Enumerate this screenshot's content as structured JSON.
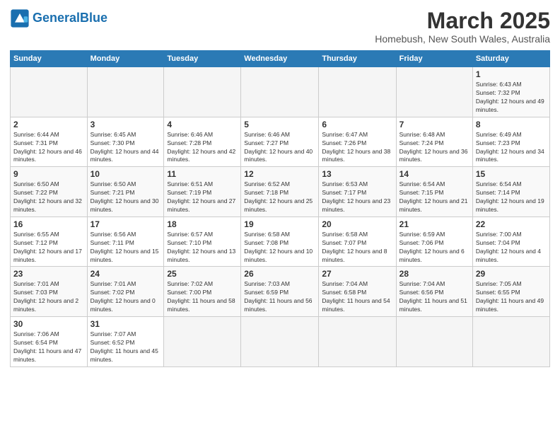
{
  "header": {
    "logo_general": "General",
    "logo_blue": "Blue",
    "title": "March 2025",
    "subtitle": "Homebush, New South Wales, Australia"
  },
  "columns": [
    "Sunday",
    "Monday",
    "Tuesday",
    "Wednesday",
    "Thursday",
    "Friday",
    "Saturday"
  ],
  "weeks": [
    {
      "days": [
        {
          "num": "",
          "info": ""
        },
        {
          "num": "",
          "info": ""
        },
        {
          "num": "",
          "info": ""
        },
        {
          "num": "",
          "info": ""
        },
        {
          "num": "",
          "info": ""
        },
        {
          "num": "",
          "info": ""
        },
        {
          "num": "1",
          "info": "Sunrise: 6:43 AM\nSunset: 7:32 PM\nDaylight: 12 hours and 49 minutes."
        }
      ]
    },
    {
      "days": [
        {
          "num": "2",
          "info": "Sunrise: 6:44 AM\nSunset: 7:31 PM\nDaylight: 12 hours and 46 minutes."
        },
        {
          "num": "3",
          "info": "Sunrise: 6:45 AM\nSunset: 7:30 PM\nDaylight: 12 hours and 44 minutes."
        },
        {
          "num": "4",
          "info": "Sunrise: 6:46 AM\nSunset: 7:28 PM\nDaylight: 12 hours and 42 minutes."
        },
        {
          "num": "5",
          "info": "Sunrise: 6:46 AM\nSunset: 7:27 PM\nDaylight: 12 hours and 40 minutes."
        },
        {
          "num": "6",
          "info": "Sunrise: 6:47 AM\nSunset: 7:26 PM\nDaylight: 12 hours and 38 minutes."
        },
        {
          "num": "7",
          "info": "Sunrise: 6:48 AM\nSunset: 7:24 PM\nDaylight: 12 hours and 36 minutes."
        },
        {
          "num": "8",
          "info": "Sunrise: 6:49 AM\nSunset: 7:23 PM\nDaylight: 12 hours and 34 minutes."
        }
      ]
    },
    {
      "days": [
        {
          "num": "9",
          "info": "Sunrise: 6:50 AM\nSunset: 7:22 PM\nDaylight: 12 hours and 32 minutes."
        },
        {
          "num": "10",
          "info": "Sunrise: 6:50 AM\nSunset: 7:21 PM\nDaylight: 12 hours and 30 minutes."
        },
        {
          "num": "11",
          "info": "Sunrise: 6:51 AM\nSunset: 7:19 PM\nDaylight: 12 hours and 27 minutes."
        },
        {
          "num": "12",
          "info": "Sunrise: 6:52 AM\nSunset: 7:18 PM\nDaylight: 12 hours and 25 minutes."
        },
        {
          "num": "13",
          "info": "Sunrise: 6:53 AM\nSunset: 7:17 PM\nDaylight: 12 hours and 23 minutes."
        },
        {
          "num": "14",
          "info": "Sunrise: 6:54 AM\nSunset: 7:15 PM\nDaylight: 12 hours and 21 minutes."
        },
        {
          "num": "15",
          "info": "Sunrise: 6:54 AM\nSunset: 7:14 PM\nDaylight: 12 hours and 19 minutes."
        }
      ]
    },
    {
      "days": [
        {
          "num": "16",
          "info": "Sunrise: 6:55 AM\nSunset: 7:12 PM\nDaylight: 12 hours and 17 minutes."
        },
        {
          "num": "17",
          "info": "Sunrise: 6:56 AM\nSunset: 7:11 PM\nDaylight: 12 hours and 15 minutes."
        },
        {
          "num": "18",
          "info": "Sunrise: 6:57 AM\nSunset: 7:10 PM\nDaylight: 12 hours and 13 minutes."
        },
        {
          "num": "19",
          "info": "Sunrise: 6:58 AM\nSunset: 7:08 PM\nDaylight: 12 hours and 10 minutes."
        },
        {
          "num": "20",
          "info": "Sunrise: 6:58 AM\nSunset: 7:07 PM\nDaylight: 12 hours and 8 minutes."
        },
        {
          "num": "21",
          "info": "Sunrise: 6:59 AM\nSunset: 7:06 PM\nDaylight: 12 hours and 6 minutes."
        },
        {
          "num": "22",
          "info": "Sunrise: 7:00 AM\nSunset: 7:04 PM\nDaylight: 12 hours and 4 minutes."
        }
      ]
    },
    {
      "days": [
        {
          "num": "23",
          "info": "Sunrise: 7:01 AM\nSunset: 7:03 PM\nDaylight: 12 hours and 2 minutes."
        },
        {
          "num": "24",
          "info": "Sunrise: 7:01 AM\nSunset: 7:02 PM\nDaylight: 12 hours and 0 minutes."
        },
        {
          "num": "25",
          "info": "Sunrise: 7:02 AM\nSunset: 7:00 PM\nDaylight: 11 hours and 58 minutes."
        },
        {
          "num": "26",
          "info": "Sunrise: 7:03 AM\nSunset: 6:59 PM\nDaylight: 11 hours and 56 minutes."
        },
        {
          "num": "27",
          "info": "Sunrise: 7:04 AM\nSunset: 6:58 PM\nDaylight: 11 hours and 54 minutes."
        },
        {
          "num": "28",
          "info": "Sunrise: 7:04 AM\nSunset: 6:56 PM\nDaylight: 11 hours and 51 minutes."
        },
        {
          "num": "29",
          "info": "Sunrise: 7:05 AM\nSunset: 6:55 PM\nDaylight: 11 hours and 49 minutes."
        }
      ]
    },
    {
      "days": [
        {
          "num": "30",
          "info": "Sunrise: 7:06 AM\nSunset: 6:54 PM\nDaylight: 11 hours and 47 minutes."
        },
        {
          "num": "31",
          "info": "Sunrise: 7:07 AM\nSunset: 6:52 PM\nDaylight: 11 hours and 45 minutes."
        },
        {
          "num": "",
          "info": ""
        },
        {
          "num": "",
          "info": ""
        },
        {
          "num": "",
          "info": ""
        },
        {
          "num": "",
          "info": ""
        },
        {
          "num": "",
          "info": ""
        }
      ]
    }
  ]
}
